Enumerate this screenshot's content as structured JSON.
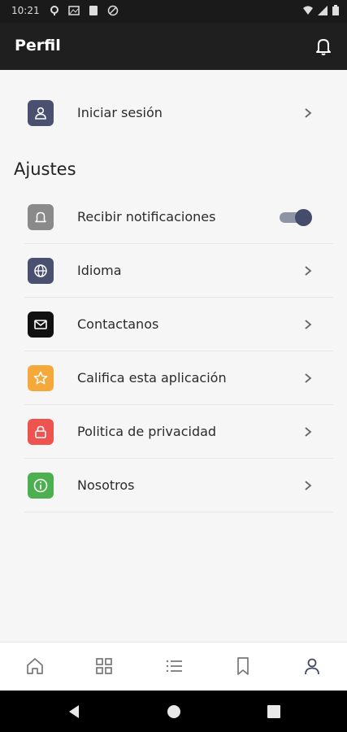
{
  "status_bar": {
    "time": "10:21"
  },
  "app_bar": {
    "title": "Perfil"
  },
  "login": {
    "label": "Iniciar sesión"
  },
  "settings": {
    "title": "Ajustes",
    "notifications": {
      "label": "Recibir notificaciones",
      "enabled": true
    },
    "language": {
      "label": "Idioma"
    },
    "contact": {
      "label": "Contactanos"
    },
    "rate": {
      "label": "Califica esta aplicación"
    },
    "privacy": {
      "label": "Politica de privacidad"
    },
    "about": {
      "label": "Nosotros"
    }
  },
  "colors": {
    "app_bar_bg": "#1f1f1f",
    "accent": "#444b6b",
    "bell_icon_bg": "#8a8a8a",
    "language_icon_bg": "#4a5070",
    "contact_icon_bg": "#111111",
    "rate_icon_bg": "#f6a93b",
    "privacy_icon_bg": "#ef5350",
    "about_icon_bg": "#4caf50",
    "frame_border": "#8ec63f"
  },
  "bottom_nav": [
    "home-icon",
    "grid-icon",
    "list-icon",
    "bookmark-icon",
    "profile-icon"
  ],
  "bottom_nav_active": "profile-icon"
}
